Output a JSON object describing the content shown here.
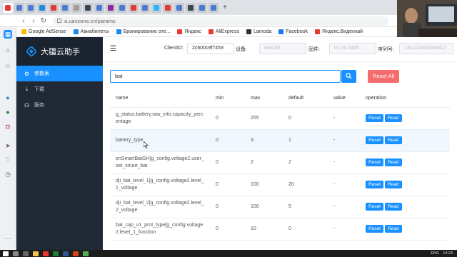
{
  "browser": {
    "url": "a.uavzone.cn/params",
    "bookmarks": [
      "Google AdSense",
      "Авиабилеты",
      "Бронирование оте...",
      "Яндекс",
      "AliExpress",
      "Lamoda",
      "Facebook",
      "Яндекс.Видеохай"
    ],
    "tab_colors": [
      "#e53935",
      "#4a7bd0",
      "#4a7bd0",
      "#1e88e5",
      "#e53935",
      "#4a7bd0",
      "#9e9e9e",
      "#37474f",
      "#4a7bd0",
      "#8e24aa",
      "#4a7bd0",
      "#e53935",
      "#4a7bd0",
      "#29b6f6",
      "#e53935",
      "#4a7bd0",
      "#37474f",
      "#4a7bd0",
      "#4a7bd0"
    ]
  },
  "app": {
    "title": "大疆云助手",
    "nav": [
      {
        "label": "参数表",
        "icon": "gear-icon",
        "active": true
      },
      {
        "label": "下载",
        "icon": "download-icon",
        "active": false
      },
      {
        "label": "服务",
        "icon": "headset-icon",
        "active": false
      }
    ]
  },
  "header": {
    "client_id_label": "ClientID:",
    "client_id_value": "2c600c9f7453",
    "device_label": "设备:",
    "device_value": "wm160",
    "firmware_label": "固件:",
    "firmware_value": "01.00.0400",
    "serial_label": "序列号:",
    "serial_value": "1SDJZA600400C2"
  },
  "search": {
    "query": "bat",
    "reset_all_label": "Reset All"
  },
  "table": {
    "headers": [
      "name",
      "min",
      "max",
      "default",
      "value",
      "operation"
    ],
    "reset_label": "Reset",
    "read_label": "Read",
    "rows": [
      {
        "name": "g_status.battery.raw_info.capacity_percentage",
        "min": "0",
        "max": "255",
        "default": "0",
        "value": "-"
      },
      {
        "name": "battery_type",
        "min": "0",
        "max": "3",
        "default": "1",
        "value": "-"
      },
      {
        "name": "enSmartBatGH[g_config.voltage2.user_set_smart_bat",
        "min": "0",
        "max": "2",
        "default": "2",
        "value": "-"
      },
      {
        "name": "dji_bat_level_1[g_config.voltage2.level_1_voltage",
        "min": "0",
        "max": "100",
        "default": "20",
        "value": "-"
      },
      {
        "name": "dji_bat_level_2[g_config.voltage2.level_2_voltage",
        "min": "0",
        "max": "100",
        "default": "5",
        "value": "-"
      },
      {
        "name": "bat_cap_v1_prot_type[g_config.voltage2.level_1_function",
        "min": "0",
        "max": "10",
        "default": "0",
        "value": "-"
      }
    ]
  },
  "taskbar": {
    "lang": "ENG",
    "time": "14:23"
  }
}
